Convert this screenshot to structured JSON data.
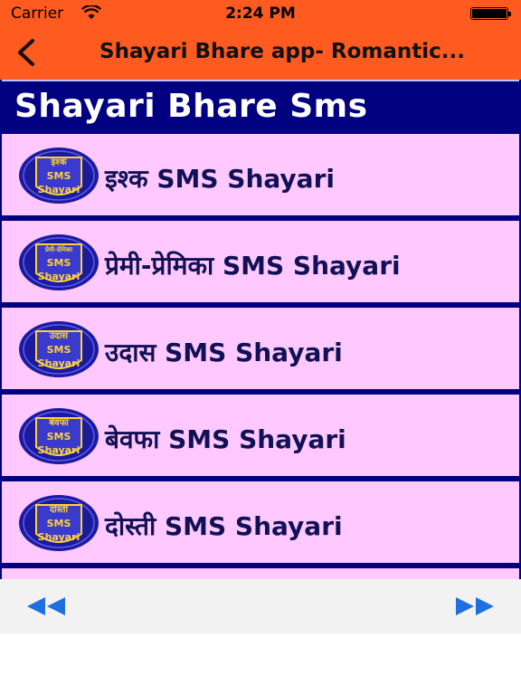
{
  "status": {
    "carrier": "Carrier",
    "time": "2:24 PM"
  },
  "nav": {
    "title": "Shayari Bhare app- Romantic..."
  },
  "list": {
    "header": "Shayari Bhare Sms",
    "badge_sms": "SMS",
    "badge_shayari": "Shayari",
    "items": [
      {
        "label": "इश्क SMS Shayari",
        "badge_top": "इश्क"
      },
      {
        "label": "प्रेमी-प्रेमिका SMS Shayari",
        "badge_top": "प्रेमी-प्रेमिका"
      },
      {
        "label": "उदास SMS Shayari",
        "badge_top": "उदास"
      },
      {
        "label": "बेवफा SMS Shayari",
        "badge_top": "बेवफा"
      },
      {
        "label": "दोस्ती SMS Shayari",
        "badge_top": "दोस्ती"
      }
    ]
  },
  "colors": {
    "nav_bg": "#ff5a1f",
    "list_bg": "#000080",
    "row_bg": "#ffc8ff",
    "footer_arrows": "#1e6fe0"
  }
}
